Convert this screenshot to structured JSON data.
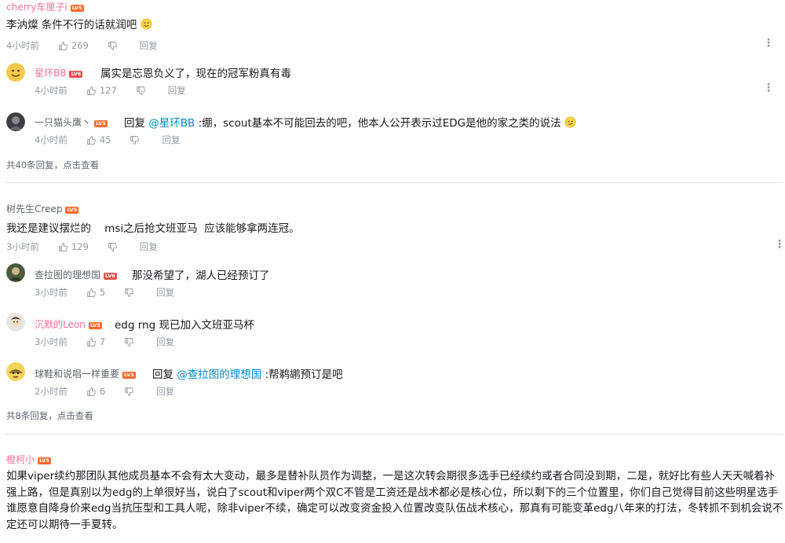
{
  "threads": [
    {
      "comment": {
        "username": "cherry车厘子i",
        "level": "LV5",
        "text": "李汭燦 条件不行的话就润吧",
        "time": "4小时前",
        "likes": "269",
        "reply_label": "回复"
      },
      "replies": [
        {
          "username": "星环BB",
          "level": "LV6",
          "text": "属实是忘恩负义了，现在的冠军粉真有毒",
          "time": "4小时前",
          "likes": "127",
          "reply_label": "回复"
        },
        {
          "username": "一只猫头鹰丶",
          "level": "LV5",
          "prefix": "回复",
          "mention": "@星环BB",
          "text": ":绷，scout基本不可能回去的吧，他本人公开表示过EDG是他的家之类的说法",
          "time": "4小时前",
          "likes": "45",
          "reply_label": "回复"
        }
      ],
      "view_more": "共40条回复，点击查看"
    },
    {
      "comment": {
        "username": "树先生Creep",
        "level": "LV5",
        "text": "我还是建议摆烂的    msi之后抢文班亚马  应该能够拿两连冠。",
        "time": "3小时前",
        "likes": "129",
        "reply_label": "回复"
      },
      "replies": [
        {
          "username": "查拉图的理想国",
          "level": "LV6",
          "text": "那没希望了，湖人已经预订了",
          "time": "3小时前",
          "likes": "5",
          "reply_label": "回复"
        },
        {
          "username": "沉默的Leon",
          "level": "LV5",
          "text": "edg rng 现已加入文班亚马杯",
          "time": "3小时前",
          "likes": "7",
          "reply_label": "回复"
        },
        {
          "username": "球鞋和说唱一样重要",
          "level": "LV5",
          "prefix": "回复",
          "mention": "@查拉图的理想国",
          "text": ":帮鹈鹕预订是吧",
          "time": "2小时前",
          "likes": "6",
          "reply_label": "回复"
        }
      ],
      "view_more": "共8条回复，点击查看"
    },
    {
      "comment": {
        "username": "橙柯小",
        "level": "LV5",
        "text": "如果viper续约那团队其他成员基本不会有太大变动，最多是替补队员作为调整，一是这次转会期很多选手已经续约或者合同没到期，二是，就好比有些人天天喊着补强上路，但是真别以为edg的上单很好当，说白了scout和viper两个双C不管是工资还是战术都必是核心位，所以剩下的三个位置里，你们自己觉得目前这些明星选手谁愿意自降身价来edg当抗压型和工具人呢，除非viper不续，确定可以改变资金投入位置改变队伍战术核心，那真有可能变革edg八年来的打法，冬转抓不到机会说不定还可以期待一手夏转。"
      }
    }
  ],
  "colors": {
    "username": "#61666d",
    "username_vip": "#fb7299",
    "mention": "#008ac5",
    "meta": "#9499a0",
    "level_badge": "#ff6a2a"
  },
  "icons": [
    "like-icon",
    "dislike-icon",
    "more-icon",
    "emoji-smile-icon"
  ]
}
